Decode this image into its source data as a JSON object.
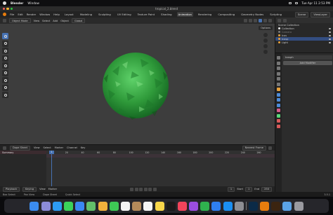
{
  "macbar": {
    "app_name": "Blender",
    "menu": [
      "Window"
    ],
    "clock": "Tue Apr 11  2:53 PM"
  },
  "window": {
    "title": "tropical_2.blend"
  },
  "topmenu": {
    "items": [
      "File",
      "Edit",
      "Render",
      "Window",
      "Help"
    ],
    "workspaces": [
      "Layout",
      "Modeling",
      "Sculpting",
      "UV Editing",
      "Texture Paint",
      "Shading",
      "Animation",
      "Rendering",
      "Compositing",
      "Geometry Nodes",
      "Scripting"
    ],
    "active_workspace": "Animation",
    "scene_label": "Scene",
    "view_layer_label": "ViewLayer"
  },
  "viewport": {
    "mode": "Object Mode",
    "menus": [
      "View",
      "Select",
      "Add",
      "Object"
    ],
    "orientation": "Global",
    "options": "Options"
  },
  "outliner": {
    "rows": [
      {
        "label": "Scene Collection",
        "color": "#c8c8c8"
      },
      {
        "label": "Collection",
        "color": "#c8c8c8"
      },
      {
        "label": "Camera",
        "color": "#7a7a7a"
      },
      {
        "label": "Icos",
        "color": "#e8a13a"
      },
      {
        "label": "Icosp",
        "color": "#e8a13a"
      },
      {
        "label": "Light",
        "color": "#e8a13a"
      }
    ]
  },
  "properties": {
    "object_name": "Icosph",
    "modifier_button": "Add Modifier"
  },
  "dopesheet": {
    "editor": "Dope Sheet",
    "menus": [
      "View",
      "Select",
      "Marker",
      "Channel",
      "Key"
    ],
    "nearest_frame": "Nearest Frame",
    "summary": "Summary",
    "ruler": [
      "0",
      "20",
      "40",
      "60",
      "80",
      "100",
      "120",
      "140",
      "160",
      "180",
      "200",
      "220",
      "240",
      "260"
    ],
    "current_frame": "1"
  },
  "timeline": {
    "playback": "Playback",
    "keying": "Keying",
    "view": "View",
    "marker": "Marker",
    "frame": "1",
    "start_label": "Start",
    "start": "1",
    "end_label": "End",
    "end": "250"
  },
  "status": {
    "items": [
      "Box Select",
      "Pan View",
      "Dope Sheet",
      "Quick Select"
    ],
    "version": "3.5.1"
  },
  "dock": {
    "apps": [
      {
        "name": "finder-icon",
        "color": "#3b8cf0"
      },
      {
        "name": "launchpad-icon",
        "color": "#8b8bd8"
      },
      {
        "name": "safari-icon",
        "color": "#2d9cf4"
      },
      {
        "name": "messages-icon",
        "color": "#3bd25a"
      },
      {
        "name": "mail-icon",
        "color": "#3a87f2"
      },
      {
        "name": "maps-icon",
        "color": "#62c06a"
      },
      {
        "name": "photos-icon",
        "color": "#f2b13c"
      },
      {
        "name": "facetime-icon",
        "color": "#3ec855"
      },
      {
        "name": "calendar-icon",
        "color": "#f4f4f4"
      },
      {
        "name": "contacts-icon",
        "color": "#b48a5a"
      },
      {
        "name": "reminders-icon",
        "color": "#f4f4f4"
      },
      {
        "name": "notes-icon",
        "color": "#f7d64a"
      },
      {
        "name": "appletv-icon",
        "color": "#1a1a1a"
      },
      {
        "name": "music-icon",
        "color": "#f2445a"
      },
      {
        "name": "podcasts-icon",
        "color": "#9b4de0"
      },
      {
        "name": "numbers-icon",
        "color": "#2fb14e"
      },
      {
        "name": "keynote-icon",
        "color": "#2f7ff0"
      },
      {
        "name": "appstore-icon",
        "color": "#1b8ff2"
      },
      {
        "name": "settings-icon",
        "color": "#8e8e93"
      },
      {
        "name": "photoshop-icon",
        "color": "#0b2a47"
      },
      {
        "name": "blender-icon",
        "color": "#e87d0d"
      },
      {
        "name": "illustrator-icon",
        "color": "#3b2410"
      },
      {
        "name": "preview-icon",
        "color": "#5aa3e8"
      },
      {
        "name": "trash-icon",
        "color": "#9a9aa0"
      }
    ]
  }
}
